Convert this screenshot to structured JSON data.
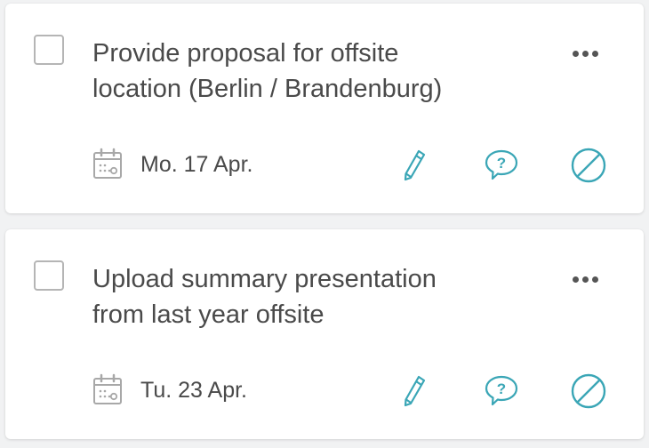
{
  "tasks": [
    {
      "title": "Provide proposal for offsite\nlocation (Berlin / Brandenburg)",
      "date": "Mo. 17 Apr.",
      "icons": [
        "calendar-icon",
        "pencil-icon",
        "comment-question-icon",
        "block-icon",
        "more-icon"
      ]
    },
    {
      "title": "Upload summary presentation\nfrom last year offsite",
      "date": "Tu. 23 Apr.",
      "icons": [
        "calendar-icon",
        "pencil-icon",
        "comment-question-icon",
        "block-icon",
        "more-icon"
      ]
    }
  ],
  "colors": {
    "accent": "#3aa6b6",
    "text": "#4a4a4a",
    "icon_gray": "#a8a8a8",
    "checkbox_border": "#b5b5b5",
    "background": "#f1f2f3",
    "card": "#ffffff"
  }
}
